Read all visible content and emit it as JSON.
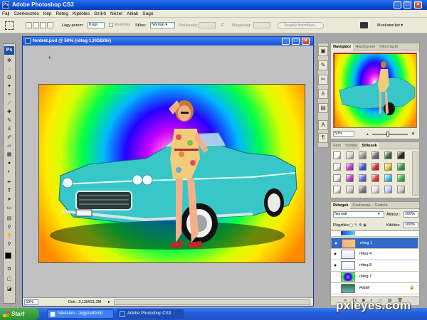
{
  "window": {
    "title": "Adobe Photoshop CS3",
    "app_icon_label": "Ps"
  },
  "menu": [
    "Fájl",
    "Szerkesztés",
    "Kép",
    "Réteg",
    "Kijelölés",
    "Szűrő",
    "Nézet",
    "Ablak",
    "Súgó"
  ],
  "options": {
    "feather_label": "Lágy perem:",
    "feather_value": "0 kpt",
    "antialias_label": "Élsimítás",
    "style_label": "Stílus:",
    "style_value": "Normál",
    "width_label": "Szélesség:",
    "height_label": "Magasság:",
    "refine_edge": "Szegély finomítása...",
    "workspace": "Munkaterület ▾"
  },
  "toolbox": {
    "logo": "Ps"
  },
  "document": {
    "title": "fordret.psd @ 50% (réteg 1,RGB/8#)",
    "zoom": "50%",
    "doc_size": "Dok.: 3,12M/31,2M"
  },
  "navigator": {
    "tabs": [
      "Navigátor",
      "Hisztogram",
      "Információ"
    ],
    "zoom": "50%"
  },
  "styles_panel": {
    "tabs": [
      "Szín",
      "Színtár",
      "Stílusok"
    ],
    "swatch_colors": [
      "#ffffff",
      "#d7d7d7",
      "#9a9a9a",
      "#6e6e6e",
      "#3a6b3a",
      "#202020",
      "#f4f4f4",
      "#cc3ad1",
      "#3b5bd8",
      "#d92d2d",
      "#e0d82a",
      "#2fa03a",
      "#f4f4f4",
      "#c83ad8",
      "#5a70e0",
      "#e04040",
      "#40c8e8",
      "#2bbf4a",
      "#f4f4f4",
      "#d6d6d6",
      "#7f7f7f",
      "#e8e8e8",
      "#b7d3ff",
      "#d0d0d0"
    ]
  },
  "layers_panel": {
    "tabs": [
      "Rétegek",
      "Csatornák",
      "Görbék"
    ],
    "blend_mode": "Normál",
    "opacity_label": "Átlátsz.:",
    "opacity_value": "100%",
    "lock_label": "Rögzítés:",
    "fill_label": "Kitöltés:",
    "fill_value": "100%",
    "layers": [
      {
        "name": "réteg 1",
        "selected": true,
        "visible": true
      },
      {
        "name": "réteg 4",
        "selected": false,
        "visible": true
      },
      {
        "name": "réteg 8",
        "selected": false,
        "visible": true
      },
      {
        "name": "réteg 7",
        "selected": false,
        "visible": false
      },
      {
        "name": "Háttér",
        "selected": false,
        "visible": false
      }
    ]
  },
  "taskbar": {
    "start": "Start",
    "items": [
      {
        "label": "Névtelen - Jegyzettömb",
        "active": false
      },
      {
        "label": "Adobe Photoshop CS3",
        "active": true
      }
    ]
  },
  "watermark": "pxleyes.com"
}
